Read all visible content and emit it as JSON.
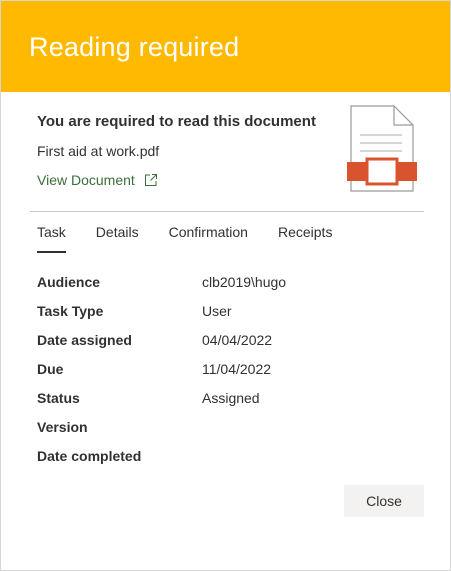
{
  "header": {
    "title": "Reading required",
    "color": "#ffb900"
  },
  "document": {
    "heading": "You are required to read this document",
    "filename": "First aid at work.pdf",
    "view_link": "View Document",
    "icon": "pdf-file-icon",
    "accent_color": "#d9532e"
  },
  "tabs": [
    {
      "label": "Task",
      "active": true
    },
    {
      "label": "Details",
      "active": false
    },
    {
      "label": "Confirmation",
      "active": false
    },
    {
      "label": "Receipts",
      "active": false
    }
  ],
  "fields": [
    {
      "label": "Audience",
      "value": "clb2019\\hugo"
    },
    {
      "label": "Task Type",
      "value": "User"
    },
    {
      "label": "Date assigned",
      "value": "04/04/2022"
    },
    {
      "label": "Due",
      "value": "11/04/2022"
    },
    {
      "label": "Status",
      "value": "Assigned"
    },
    {
      "label": "Version",
      "value": ""
    },
    {
      "label": "Date completed",
      "value": ""
    }
  ],
  "footer": {
    "close_label": "Close"
  }
}
